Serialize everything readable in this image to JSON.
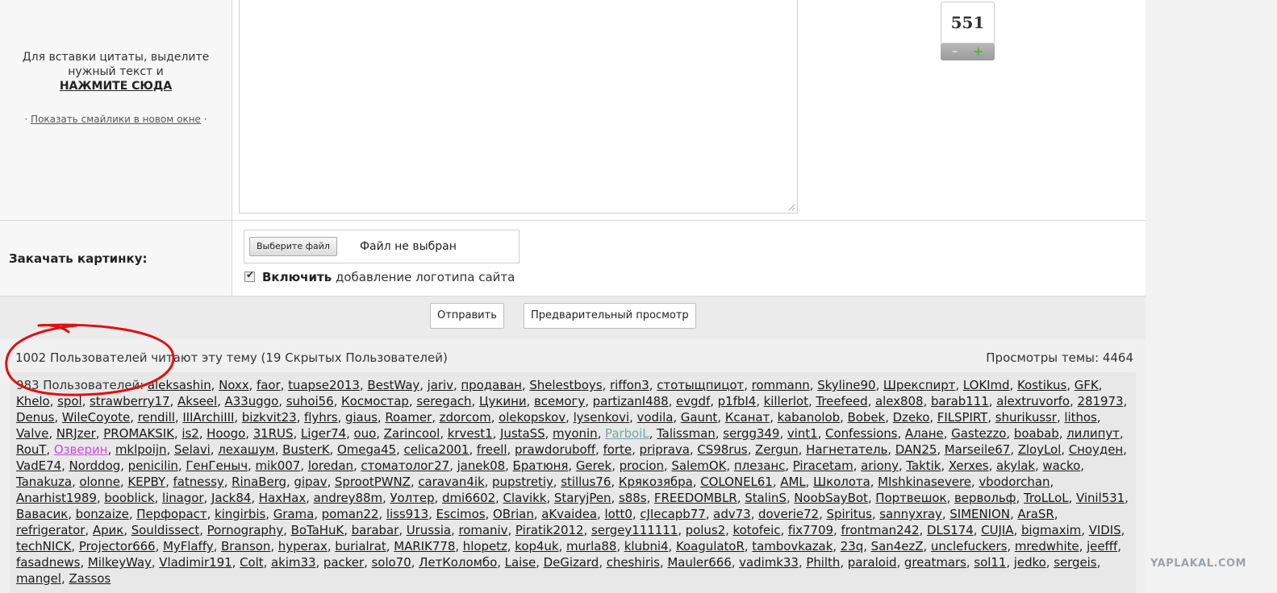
{
  "reply": {
    "quote_hint": "Для вставки цитаты, выделите нужный текст и",
    "quote_action": "НАЖМИТЕ СЮДА",
    "smiles_prefix": "·",
    "smiles_link": "Показать смайлики в новом окне",
    "smiles_suffix": "·"
  },
  "vote": {
    "count": "551",
    "minus": "–",
    "plus": "+"
  },
  "upload": {
    "label": "Закачать картинку:",
    "file_button": "Выберите файл",
    "file_status": "Файл не выбран",
    "logo_enable": "Включить",
    "logo_rest": "добавление логотипа сайта",
    "logo_checked": true
  },
  "actions": {
    "send": "Отправить",
    "preview": "Предварительный просмотр"
  },
  "readers": {
    "header": "1002 Пользователей читают эту тему (19 Скрытых Пользователей)",
    "views": "Просмотры темы: 4464",
    "lead": "983 Пользователей:",
    "users": [
      "aleksashin",
      "Noxx",
      "faor",
      "tuapse2013",
      "BestWay",
      "jariv",
      "продаван",
      "Shelestboys",
      "riffon3",
      "стотыщпицот",
      "rommann",
      "Skyline90",
      "Шрекспирт",
      "LOKImd",
      "Kostikus",
      "GFK",
      "Khelo",
      "spol",
      "strawberry17",
      "Akseel",
      "A33uggo",
      "suhoi56",
      "Космостар",
      "seregach",
      "Цукини",
      "всемогу",
      "partizanI488",
      "evgdf",
      "p1fbI4",
      "killerlot",
      "Treefeed",
      "alex808",
      "barab111",
      "alextruvorfo",
      "281973",
      "Denus",
      "WileCoyote",
      "rendill",
      "IIIArchiIII",
      "bizkvit23",
      "flyhrs",
      "giaus",
      "Roamer",
      "zdorcom",
      "olekopskov",
      "lysenkovi",
      "vodila",
      "Gaunt",
      "Ксанат",
      "kabanolob",
      "Bobek",
      "Dzeko",
      "FILSPIRT",
      "shurikussr",
      "lithos",
      "Valve",
      "NRJzer",
      "PROMAKSIK",
      "is2",
      "Hoogo",
      "31RUS",
      "Liger74",
      "ouo",
      "Zarincool",
      "krvest1",
      "JustaSS",
      "myonin",
      "ParboiL",
      "Talissman",
      "sergg349",
      "vint1",
      "Confessions",
      "Алане",
      "Gastezzo",
      "boabab",
      "лилипут",
      "RouT",
      "Озверин",
      "mklpoijn",
      "Selavi",
      "лехашум",
      "BusterK",
      "Omega45",
      "celica2001",
      "freell",
      "prawdoruboff",
      "forte",
      "priprava",
      "CS98rus",
      "Zergun",
      "Нагнетатель",
      "DAN25",
      "Marseile67",
      "ZloyLol",
      "Сноуден",
      "VadE74",
      "Norddog",
      "penicilin",
      "ГенГеныч",
      "mik007",
      "loredan",
      "стоматолог27",
      "janek08",
      "Братюня",
      "Gerek",
      "procion",
      "SalemOK",
      "плезанс",
      "Piracetam",
      "ariony",
      "Taktik",
      "Xerxes",
      "akylak",
      "wacko",
      "Tanakuza",
      "olonne",
      "KEPBY",
      "fatnessy",
      "RinaBerg",
      "gipav",
      "SprootPWNZ",
      "caravan4ik",
      "pupstretiy",
      "stillus76",
      "Крякозябра",
      "COLONEL61",
      "AML",
      "Школота",
      "MIshkinasevere",
      "vbodorchan",
      "Anarhist1989",
      "booblick",
      "linagor",
      "Jack84",
      "HaxHax",
      "andrey88m",
      "Уолтер",
      "dmi6602",
      "Clavikk",
      "StaryjPen",
      "s88s",
      "FREEDOMBLR",
      "StalinS",
      "NoobSayBot",
      "Портвешок",
      "вервольф",
      "TroLLoL",
      "Vinil531",
      "Вавасик",
      "bonzaize",
      "Перфораст",
      "kingirbis",
      "Grama",
      "poman22",
      "liss913",
      "Escimos",
      "OBrian",
      "aKvaidea",
      "lott0",
      "cJIecapb77",
      "adv73",
      "doverie72",
      "Spiritus",
      "sannyxray",
      "SIMENION",
      "AraSR",
      "refrigerator",
      "Арик",
      "Souldissect",
      "Pornography",
      "BoTaHuK",
      "barabar",
      "Urussia",
      "romaniv",
      "Piratik2012",
      "sergey111111",
      "polus2",
      "kotofeic",
      "fix7709",
      "frontman242",
      "DLS174",
      "CUJIA",
      "bigmaxim",
      "VIDIS",
      "techNICK",
      "Projector666",
      "MyFlaffy",
      "Branson",
      "hyperax",
      "burialrat",
      "MARIK778",
      "hlopetz",
      "kop4uk",
      "murla88",
      "klubni4",
      "KoagulatoR",
      "tambovkazak",
      "23q",
      "San4ezZ",
      "unclefuckers",
      "mredwhite",
      "jeefff",
      "fasadnews",
      "MilkeyWay",
      "Vladimir191",
      "Colt",
      "akim33",
      "packer",
      "solo70",
      "ЛетКоломбо",
      "Laise",
      "DeGizard",
      "cheshiris",
      "Mauler666",
      "vadimk33",
      "Philth",
      "paraloid",
      "greatmars",
      "sol11",
      "jedko",
      "sergeis",
      "mangel",
      "Zassos"
    ],
    "special": {
      "ParboiL": "special-blue",
      "Озверин": "special-purple"
    }
  },
  "watermark": "YAPLAKAL.COM",
  "colors": {
    "annotation": "#e01010",
    "vote_plus": "#54b33a",
    "purple_user": "#c84ae0",
    "muted_user": "#7aa5a8"
  }
}
